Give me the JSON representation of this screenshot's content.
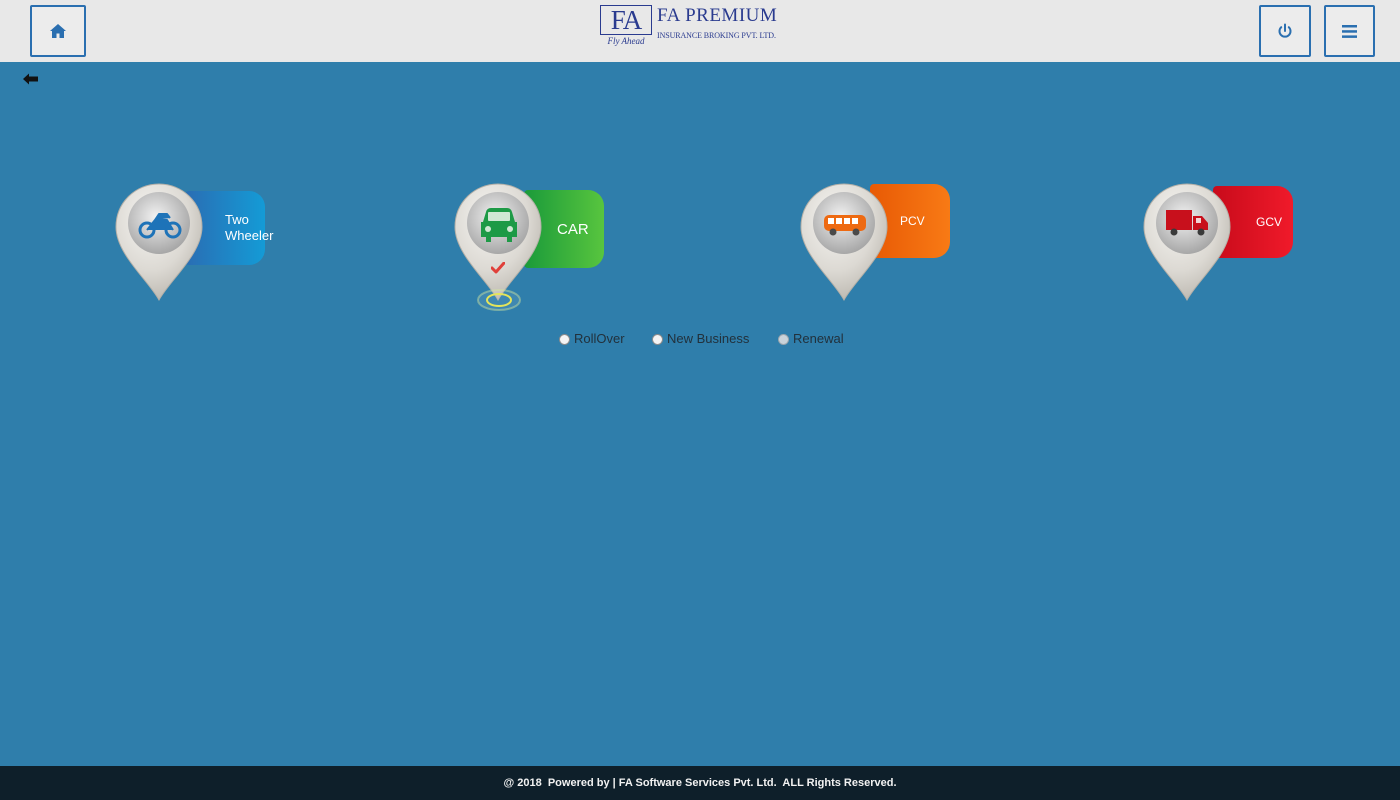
{
  "header": {
    "home_icon": "home-icon",
    "power_icon": "power-icon",
    "menu_icon": "hamburger-menu-icon",
    "logo": {
      "mark": "FA",
      "tagline": "Fly Ahead",
      "name": "FA PREMIUM",
      "subtitle": "INSURANCE BROKING PVT. LTD."
    }
  },
  "nav": {
    "back_icon": "arrow-left-icon"
  },
  "vehicles": [
    {
      "label_line1": "Two",
      "label_line2": "Wheeler",
      "icon": "motorcycle-icon",
      "color": "#149bd6",
      "selected": false
    },
    {
      "label": "CAR",
      "icon": "car-icon",
      "color": "#58c53e",
      "selected": true
    },
    {
      "label": "PCV",
      "icon": "bus-icon",
      "color": "#f87a15",
      "selected": false
    },
    {
      "label": "GCV",
      "icon": "truck-icon",
      "color": "#f01a2a",
      "selected": false
    }
  ],
  "policy_type": {
    "options": [
      {
        "label": "RollOver",
        "checked": false,
        "disabled": false
      },
      {
        "label": "New Business",
        "checked": false,
        "disabled": false
      },
      {
        "label": "Renewal",
        "checked": false,
        "disabled": true
      }
    ]
  },
  "footer": {
    "text": "@ 2018  Powered by | FA Software Services Pvt. Ltd.  ALL Rights Reserved."
  },
  "colors": {
    "background": "#2f7eab",
    "header": "#e8e8e8",
    "footer": "#0e1f2a",
    "accent": "#2a6fb0"
  }
}
